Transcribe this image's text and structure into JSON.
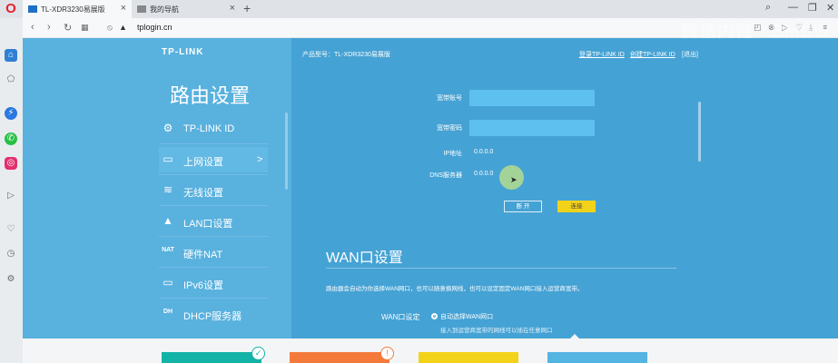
{
  "browser": {
    "tabs": [
      {
        "label": "TL-XDR3230易展版",
        "close": "×"
      },
      {
        "label": "我的导航",
        "close": "×"
      }
    ],
    "new_tab": "+",
    "window_controls": [
      "⌕",
      "—",
      "❐",
      "✕"
    ],
    "url": "tplogin.cn",
    "nav_icons": [
      "back-icon",
      "forward-icon",
      "reload-icon",
      "grid-icon",
      "not-secure-icon"
    ],
    "watermark": "微信内链 · BMDW"
  },
  "sidebar_icons": [
    "home-icon",
    "bookmark-icon",
    "messenger-icon",
    "whatsapp-icon",
    "instagram-icon",
    "send-icon",
    "heart-icon",
    "history-icon",
    "settings-icon"
  ],
  "router": {
    "logo": "TP-LINK",
    "title": "路由设置",
    "menu": [
      {
        "icon": "⚙",
        "icon_name": "gear-icon",
        "label": "TP-LINK ID",
        "active": false
      },
      {
        "icon": "▭",
        "icon_name": "monitor-icon",
        "label": "上网设置",
        "arrow": ">",
        "active": true
      },
      {
        "icon": "≋",
        "icon_name": "wifi-icon",
        "label": "无线设置",
        "active": false
      },
      {
        "icon": "▲",
        "icon_name": "lan-icon",
        "label": "LAN口设置",
        "active": false
      },
      {
        "icon": "NAT",
        "icon_name": "nat-icon",
        "label": "硬件NAT",
        "active": false
      },
      {
        "icon": "▭",
        "icon_name": "ipv6-icon",
        "label": "IPv6设置",
        "active": false
      },
      {
        "icon": "DH",
        "icon_name": "dhcp-icon",
        "label": "DHCP服务器",
        "active": false
      }
    ],
    "header": {
      "product": "产品型号：TL-XDR3230易展版",
      "links": [
        "登录TP-LINK ID",
        "创建TP-LINK ID",
        "[退出]"
      ]
    },
    "form": {
      "account_label": "宽带账号",
      "password_label": "宽带密码",
      "ip_label": "IP地址",
      "ip_value": "0.0.0.0",
      "dns_label": "DNS服务器",
      "dns_value": "0.0.0.0",
      "disconnect": "断 开",
      "connect": "连接"
    },
    "wan": {
      "title": "WAN口设置",
      "desc": "路由器会自动为你选择WAN网口，也可以随意换网线，也可以设定固定WAN网口接入运营商宽带。",
      "setting_label": "WAN口设定",
      "option": "自动选择WAN网口",
      "sub": "接入到运营商宽带的网线可以插在任意网口"
    },
    "cards": [
      {
        "color": "#14b3a7",
        "badge": "✓"
      },
      {
        "color": "#f47a3b",
        "badge": "!"
      },
      {
        "color": "#f3d21a",
        "badge": ""
      },
      {
        "color": "#54b4e2",
        "badge": ""
      }
    ]
  }
}
